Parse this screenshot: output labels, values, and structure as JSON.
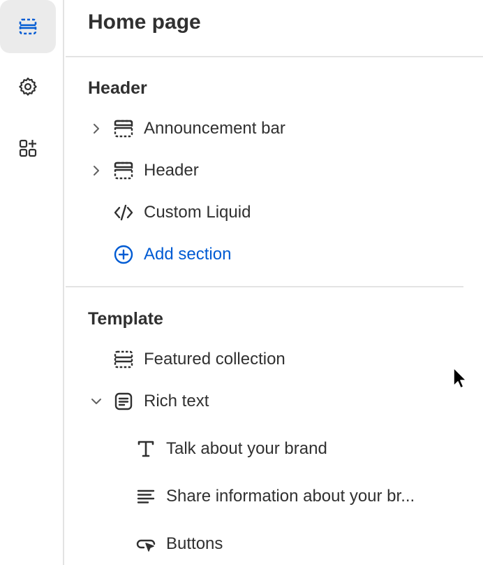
{
  "page": {
    "title": "Home page"
  },
  "rail": {
    "items": [
      {
        "icon": "sections-icon",
        "active": true
      },
      {
        "icon": "gear-icon",
        "active": false
      },
      {
        "icon": "apps-add-icon",
        "active": false
      }
    ]
  },
  "groups": {
    "header": {
      "title": "Header",
      "items": [
        {
          "label": "Announcement bar",
          "icon": "section-layout-icon",
          "expandable": true
        },
        {
          "label": "Header",
          "icon": "section-layout-icon",
          "expandable": true
        },
        {
          "label": "Custom Liquid",
          "icon": "code-icon",
          "expandable": false
        }
      ],
      "add_label": "Add section"
    },
    "template": {
      "title": "Template",
      "items": [
        {
          "label": "Featured collection",
          "icon": "collection-section-icon",
          "expandable": false
        },
        {
          "label": "Rich text",
          "icon": "text-block-icon",
          "expanded": true
        }
      ],
      "blocks": [
        {
          "label": "Talk about your brand",
          "icon": "text-heading-icon"
        },
        {
          "label": "Share information about your br...",
          "icon": "text-lines-icon"
        },
        {
          "label": "Buttons",
          "icon": "button-cursor-icon"
        }
      ]
    }
  },
  "colors": {
    "accent": "#005bd3",
    "text": "#303030",
    "divider": "#e3e3e3",
    "active_bg": "#ebebeb"
  }
}
